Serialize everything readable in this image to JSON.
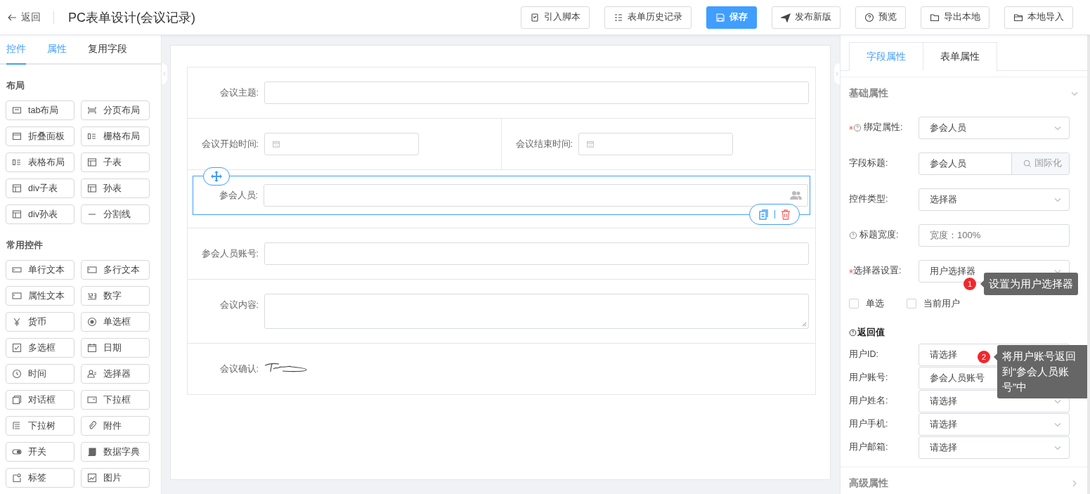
{
  "header": {
    "back": "返回",
    "title": "PC表单设计(会议记录)",
    "buttons": [
      {
        "label": "引入脚本",
        "kind": "default"
      },
      {
        "label": "表单历史记录",
        "kind": "default"
      },
      {
        "label": "保存",
        "kind": "primary"
      },
      {
        "label": "发布新版",
        "kind": "default"
      },
      {
        "label": "预览",
        "kind": "default"
      },
      {
        "label": "导出本地",
        "kind": "default"
      },
      {
        "label": "本地导入",
        "kind": "default"
      }
    ]
  },
  "sidebar": {
    "tabs": [
      {
        "label": "控件",
        "selected": true,
        "kind": "accent"
      },
      {
        "label": "属性",
        "selected": false,
        "kind": "accent"
      },
      {
        "label": "复用字段",
        "selected": false,
        "kind": "plain"
      }
    ],
    "groups": [
      {
        "title": "布局",
        "items": [
          "tab布局",
          "分页布局",
          "折叠面板",
          "栅格布局",
          "表格布局",
          "子表",
          "div子表",
          "孙表",
          "div孙表",
          "分割线"
        ]
      },
      {
        "title": "常用控件",
        "items": [
          "单行文本",
          "多行文本",
          "属性文本",
          "数字",
          "货币",
          "单选框",
          "多选框",
          "日期",
          "时间",
          "选择器",
          "对话框",
          "下拉框",
          "下拉树",
          "附件",
          "开关",
          "数据字典",
          "标签",
          "图片"
        ]
      }
    ]
  },
  "form": {
    "rows": [
      {
        "selected": false,
        "fields": [
          {
            "label": "会议主题:",
            "kind": "text"
          }
        ]
      },
      {
        "selected": false,
        "fields": [
          {
            "label": "会议开始时间:",
            "kind": "date"
          },
          {
            "label": "会议结束时间:",
            "kind": "date"
          }
        ]
      },
      {
        "selected": true,
        "fields": [
          {
            "label": "参会人员:",
            "kind": "user"
          }
        ]
      },
      {
        "selected": false,
        "fields": [
          {
            "label": "参会人员账号:",
            "kind": "text"
          }
        ]
      },
      {
        "selected": false,
        "fields": [
          {
            "label": "会议内容:",
            "kind": "textarea"
          }
        ]
      },
      {
        "selected": false,
        "fields": [
          {
            "label": "会议确认:",
            "kind": "signature"
          }
        ]
      }
    ]
  },
  "properties": {
    "tabs": [
      {
        "label": "字段属性",
        "selected": true
      },
      {
        "label": "表单属性",
        "selected": false
      }
    ],
    "basic": {
      "title": "基础属性",
      "expanded": true,
      "fields": [
        {
          "label": "绑定属性:",
          "required": true,
          "help": true,
          "kind": "select",
          "value": "参会人员"
        },
        {
          "label": "字段标题:",
          "required": false,
          "help": false,
          "kind": "addon",
          "value": "参会人员",
          "addon": "国际化"
        },
        {
          "label": "控件类型:",
          "required": false,
          "help": false,
          "kind": "select",
          "value": "选择器"
        },
        {
          "label": "标题宽度:",
          "required": false,
          "help": true,
          "kind": "input",
          "placeholder": "宽度：100%"
        },
        {
          "label": "选择器设置:",
          "required": true,
          "help": false,
          "kind": "select",
          "value": "用户选择器"
        }
      ],
      "checkboxes": [
        {
          "label": "单选",
          "checked": false
        },
        {
          "label": "当前用户",
          "checked": false
        }
      ],
      "return_title": "返回值",
      "return_fields": [
        {
          "label": "用户ID:",
          "value": "请选择"
        },
        {
          "label": "用户账号:",
          "value": "参会人员账号"
        },
        {
          "label": "用户姓名:",
          "value": "请选择"
        },
        {
          "label": "用户手机:",
          "value": "请选择"
        },
        {
          "label": "用户邮箱:",
          "value": "请选择"
        }
      ]
    },
    "advanced": {
      "title": "高级属性",
      "expanded": false
    }
  },
  "callouts": [
    {
      "number": "1",
      "text": "设置为用户选择器"
    },
    {
      "number": "2",
      "text": "将用户账号返回到“参会人员账号”中"
    }
  ]
}
